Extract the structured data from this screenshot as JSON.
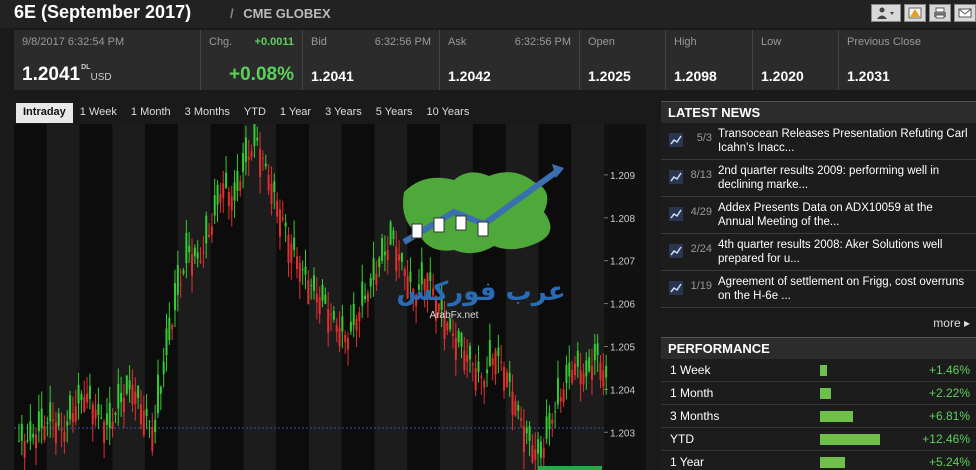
{
  "header": {
    "title": "6E (September 2017)",
    "exchange": "CME GLOBEX"
  },
  "quote": {
    "last": {
      "timestamp": "9/8/2017 6:32:54 PM",
      "price": "1.2041",
      "price_sup": "DL",
      "unit": "USD"
    },
    "change": {
      "label": "Chg.",
      "abs": "+0.0011",
      "pct": "+0.08%"
    },
    "bid": {
      "label": "Bid",
      "time": "6:32:56 PM",
      "value": "1.2041"
    },
    "ask": {
      "label": "Ask",
      "time": "6:32:56 PM",
      "value": "1.2042"
    },
    "open": {
      "label": "Open",
      "value": "1.2025"
    },
    "high": {
      "label": "High",
      "value": "1.2098"
    },
    "low": {
      "label": "Low",
      "value": "1.2020"
    },
    "prev_close": {
      "label": "Previous Close",
      "value": "1.2031"
    }
  },
  "tabs": [
    "Intraday",
    "1 Week",
    "1 Month",
    "3 Months",
    "YTD",
    "1 Year",
    "3 Years",
    "5 Years",
    "10 Years"
  ],
  "active_tab": "Intraday",
  "chart_data": {
    "type": "candlestick",
    "y_ticks": [
      "1.209",
      "1.208",
      "1.207",
      "1.206",
      "1.205",
      "1.204",
      "1.203"
    ],
    "ylim": [
      1.2024,
      1.21
    ],
    "reference_line": 1.2031,
    "colors": {
      "up": "#33cc33",
      "down": "#e03030",
      "reference": "#3355aa"
    },
    "closes": [
      1.2028,
      1.2031,
      1.2033,
      1.203,
      1.2036,
      1.2039,
      1.2034,
      1.2031,
      1.2037,
      1.2041,
      1.2035,
      1.203,
      1.2048,
      1.2062,
      1.2072,
      1.207,
      1.2078,
      1.2088,
      1.2084,
      1.2093,
      1.2098,
      1.209,
      1.2082,
      1.2074,
      1.2068,
      1.2063,
      1.206,
      1.2055,
      1.2052,
      1.2058,
      1.2064,
      1.207,
      1.2075,
      1.2068,
      1.2062,
      1.2067,
      1.206,
      1.2054,
      1.205,
      1.2046,
      1.2042,
      1.2049,
      1.2044,
      1.2035,
      1.2028,
      1.2024,
      1.2033,
      1.204,
      1.2046,
      1.2043,
      1.2048,
      1.2041
    ]
  },
  "news": {
    "title": "LATEST NEWS",
    "items": [
      {
        "date": "5/3",
        "text": "Transocean Releases Presentation Refuting Carl Icahn's Inacc..."
      },
      {
        "date": "8/13",
        "text": "2nd quarter results 2009: performing well in declining marke..."
      },
      {
        "date": "4/29",
        "text": "Addex Presents Data on ADX10059 at the Annual Meeting of the..."
      },
      {
        "date": "2/24",
        "text": "4th quarter results 2008: Aker Solutions well prepared for u..."
      },
      {
        "date": "1/19",
        "text": "Agreement of settlement on Frigg, cost overruns on the H-6e ..."
      }
    ],
    "more_label": "more"
  },
  "performance": {
    "title": "PERFORMANCE",
    "rows": [
      {
        "label": "1 Week",
        "value": "+1.46%",
        "pct": 1.46
      },
      {
        "label": "1 Month",
        "value": "+2.22%",
        "pct": 2.22
      },
      {
        "label": "3 Months",
        "value": "+6.81%",
        "pct": 6.81
      },
      {
        "label": "YTD",
        "value": "+12.46%",
        "pct": 12.46
      },
      {
        "label": "1 Year",
        "value": "+5.24%",
        "pct": 5.24
      }
    ],
    "bar_color": "#6fbf4a"
  },
  "watermark": {
    "text": "عرب فوركس",
    "subtext": "ArabFx.net"
  }
}
